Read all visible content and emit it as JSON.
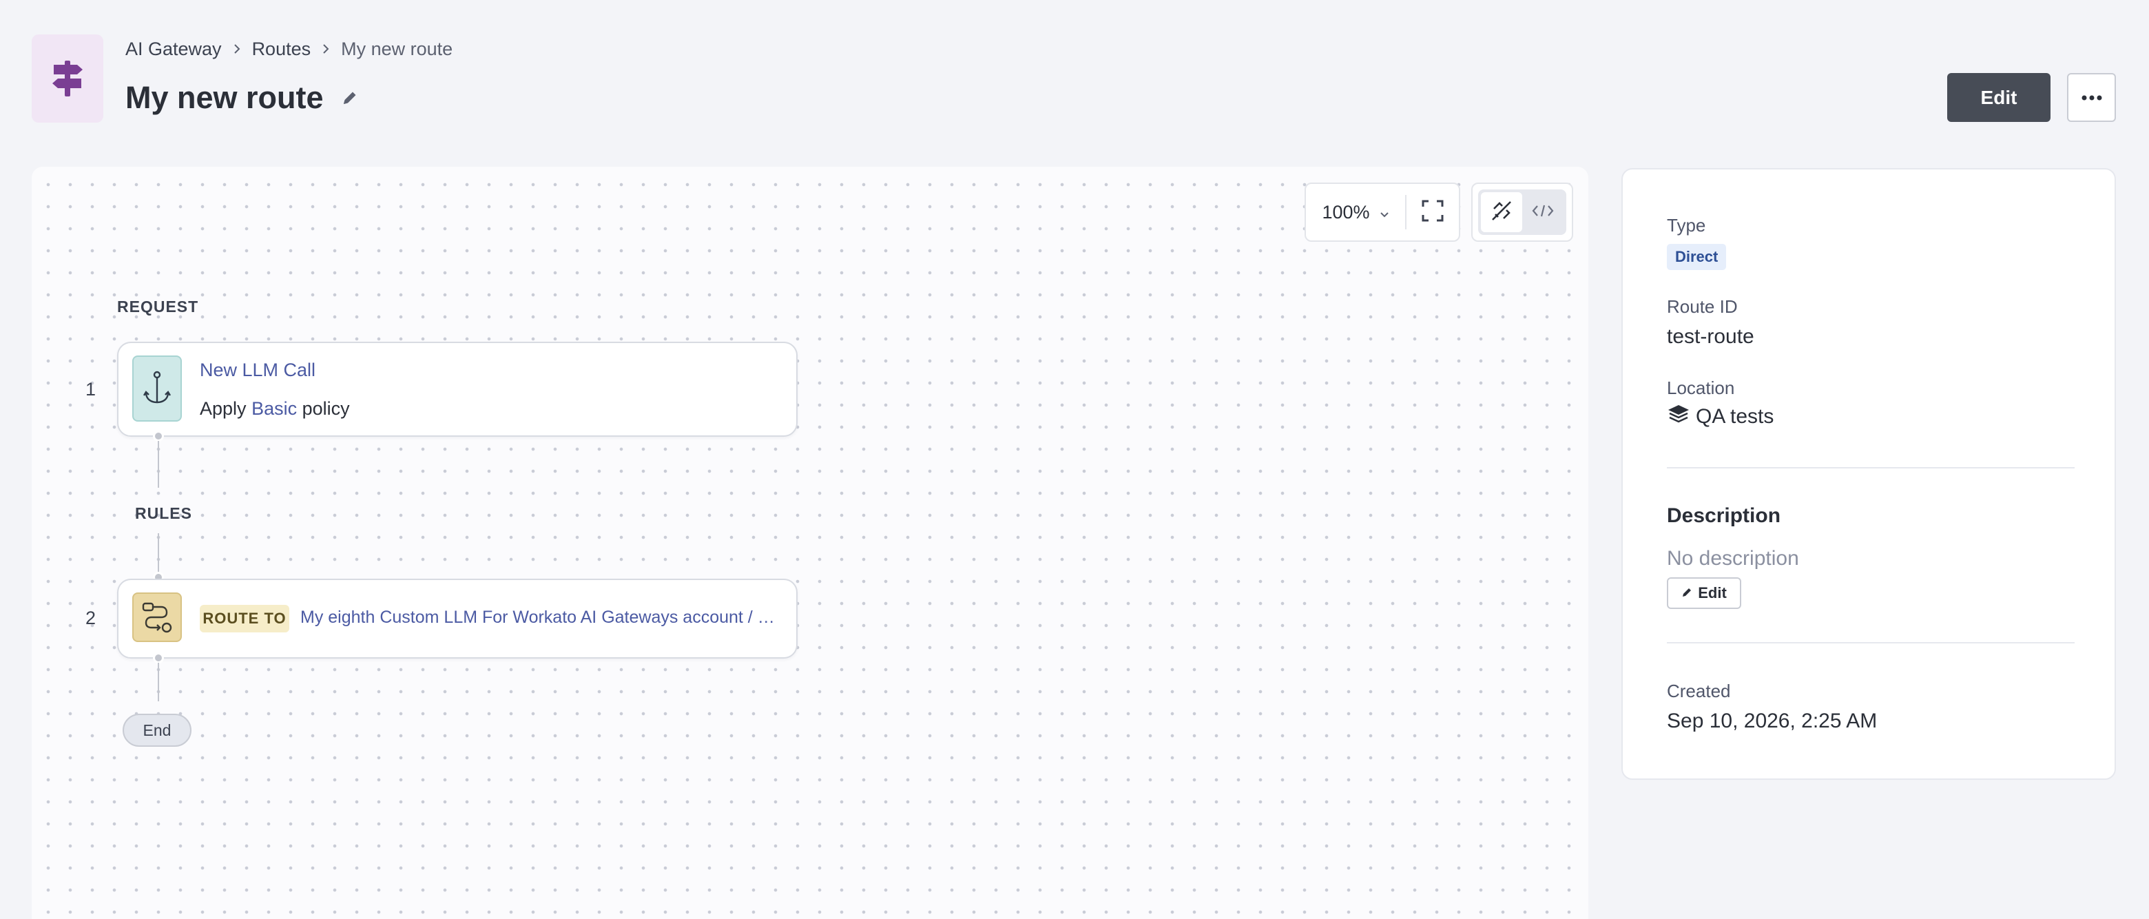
{
  "breadcrumb": {
    "items": [
      "AI Gateway",
      "Routes"
    ],
    "current": "My new route"
  },
  "header": {
    "title": "My new route",
    "edit_label": "Edit",
    "more_icon": "more-horizontal-icon"
  },
  "canvas": {
    "zoom": "100%",
    "request_label": "REQUEST",
    "rules_label": "RULES",
    "steps": [
      {
        "number": "1",
        "title": "New LLM Call",
        "desc_prefix": "Apply",
        "desc_link": "Basic",
        "desc_suffix": "policy",
        "icon": "anchor-icon"
      },
      {
        "number": "2",
        "badge": "ROUTE TO",
        "target": "My eighth Custom LLM For Workato AI Gateways account / zai-...",
        "icon": "route-icon"
      }
    ],
    "end_label": "End"
  },
  "details": {
    "type_label": "Type",
    "type_value": "Direct",
    "route_id_label": "Route ID",
    "route_id_value": "test-route",
    "location_label": "Location",
    "location_value": "QA tests",
    "description_heading": "Description",
    "description_empty": "No description",
    "description_edit_label": "Edit",
    "created_label": "Created",
    "created_value": "Sep 10, 2026, 2:25 AM"
  },
  "colors": {
    "accent_purple": "#7a3e93",
    "link_blue": "#4b5aa3",
    "primary_button": "#474c56",
    "direct_badge_bg": "#e6eefb",
    "route_badge_bg": "#f6edc9"
  }
}
